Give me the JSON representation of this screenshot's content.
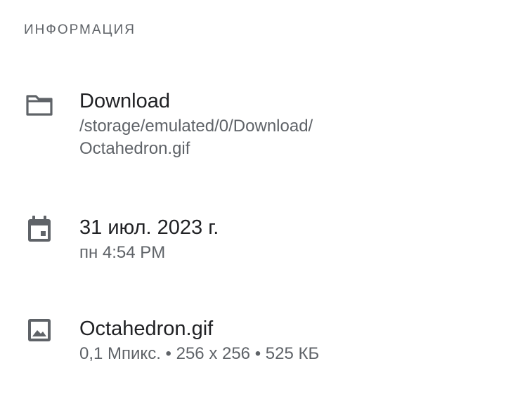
{
  "section": {
    "title": "ИНФОРМАЦИЯ"
  },
  "location": {
    "icon": "folder-icon",
    "folder": "Download",
    "path": "/storage/emulated/0/Download/\nOctahedron.gif"
  },
  "date": {
    "icon": "calendar-icon",
    "date": "31 июл. 2023 г.",
    "time": "пн 4:54 PM"
  },
  "file": {
    "icon": "image-icon",
    "name": "Octahedron.gif",
    "details": "0,1 Мпикс. • 256 x 256 • 525 КБ"
  },
  "colors": {
    "icon": "#5f6368",
    "primary_text": "#202124",
    "secondary_text": "#5f6368"
  }
}
